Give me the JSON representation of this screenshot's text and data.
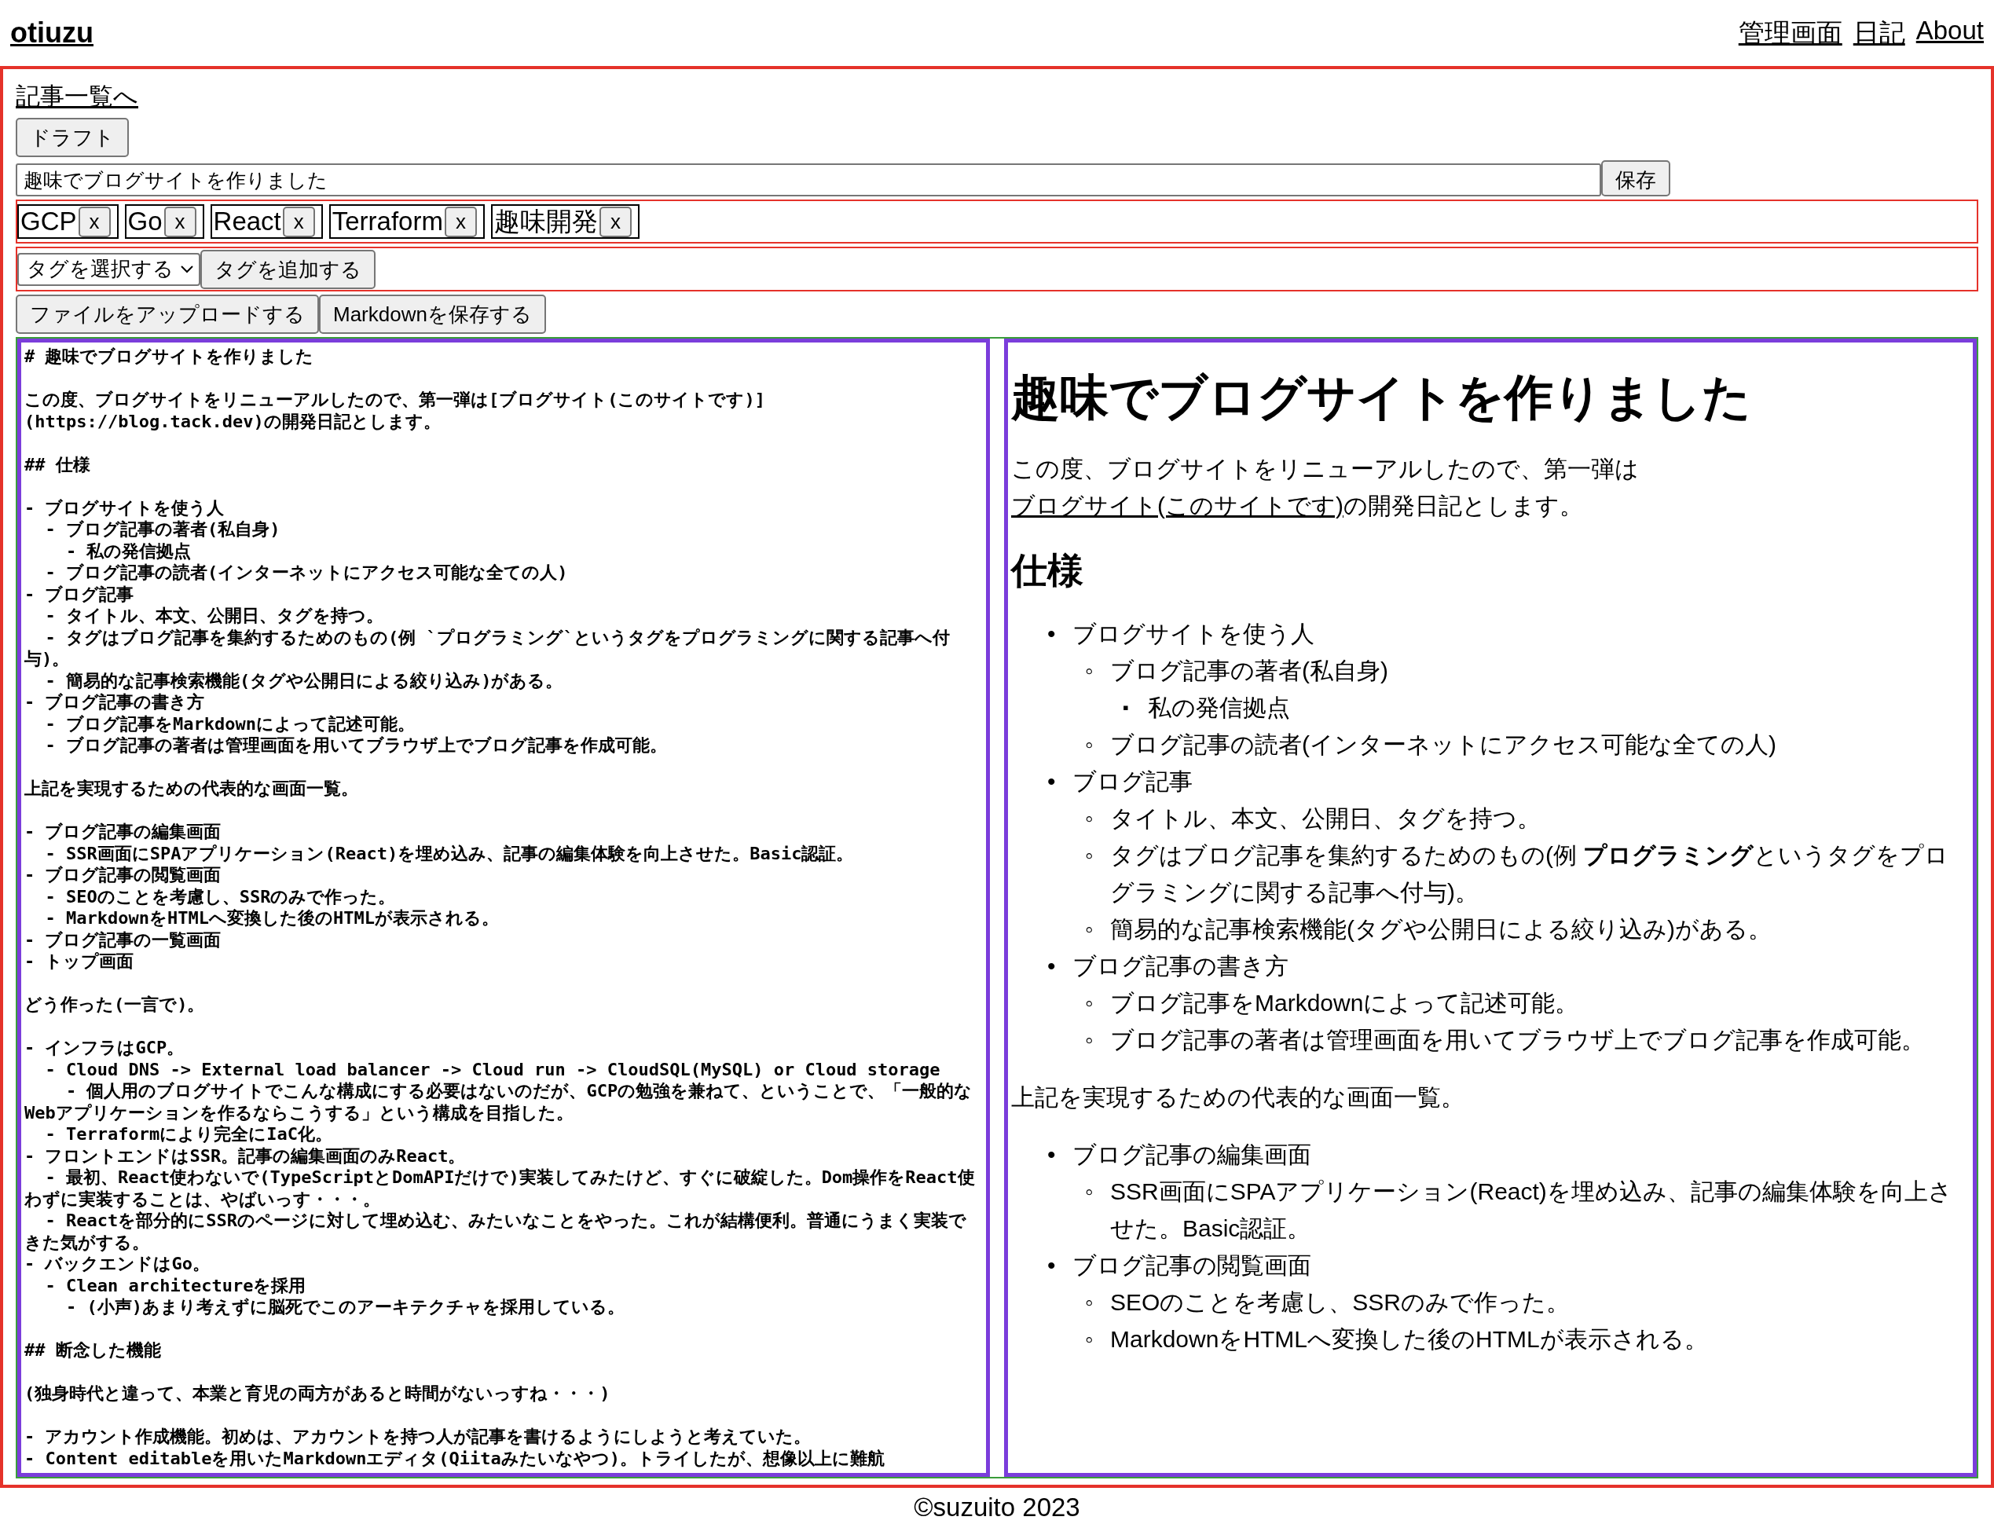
{
  "header": {
    "logo": "otiuzu",
    "nav": [
      "管理画面",
      "日記",
      "About"
    ]
  },
  "editor": {
    "back_link": "記事一覧へ",
    "draft_button": "ドラフト",
    "title_field": {
      "value": "趣味でブログサイトを作りました"
    },
    "save_button": "保存",
    "tags": [
      {
        "label": "GCP",
        "remove": "x"
      },
      {
        "label": "Go",
        "remove": "x"
      },
      {
        "label": "React",
        "remove": "x"
      },
      {
        "label": "Terraform",
        "remove": "x"
      },
      {
        "label": "趣味開発",
        "remove": "x"
      }
    ],
    "tag_select": {
      "value": "タグを選択する"
    },
    "add_tag_button": "タグを追加する",
    "upload_button": "ファイルをアップロードする",
    "save_markdown_button": "Markdownを保存する",
    "markdown_blocks": [
      [
        "# 趣味でブログサイトを作りました"
      ],
      [
        "この度、ブログサイトをリニューアルしたので、第一弾は[ブログサイト(このサイトです)](https://blog.tack.dev)の開発日記とします。"
      ],
      [
        "## 仕様"
      ],
      [
        "- ブログサイトを使う人",
        "  - ブログ記事の著者(私自身)",
        "    - 私の発信拠点",
        "  - ブログ記事の読者(インターネットにアクセス可能な全ての人)",
        "- ブログ記事",
        "  - タイトル、本文、公開日、タグを持つ。",
        "  - タグはブログ記事を集約するためのもの(例 `プログラミング`というタグをプログラミングに関する記事へ付与)。",
        "  - 簡易的な記事検索機能(タグや公開日による絞り込み)がある。",
        "- ブログ記事の書き方",
        "  - ブログ記事をMarkdownによって記述可能。",
        "  - ブログ記事の著者は管理画面を用いてブラウザ上でブログ記事を作成可能。"
      ],
      [
        "上記を実現するための代表的な画面一覧。"
      ],
      [
        "- ブログ記事の編集画面",
        "  - SSR画面にSPAアプリケーション(React)を埋め込み、記事の編集体験を向上させた。Basic認証。",
        "- ブログ記事の閲覧画面",
        "  - SEOのことを考慮し、SSRのみで作った。",
        "  - MarkdownをHTMLへ変換した後のHTMLが表示される。",
        "- ブログ記事の一覧画面",
        "- トップ画面"
      ],
      [
        "どう作った(一言で)。"
      ],
      [
        "- インフラはGCP。",
        "  - Cloud DNS -> External load balancer -> Cloud run -> CloudSQL(MySQL) or Cloud storage",
        "    - 個人用のブログサイトでこんな構成にする必要はないのだが、GCPの勉強を兼ねて、ということで、「一般的なWebアプリケーションを作るならこうする」という構成を目指した。",
        "  - Terraformにより完全にIaC化。",
        "- フロントエンドはSSR。記事の編集画面のみReact。",
        "  - 最初、React使わないで(TypeScriptとDomAPIだけで)実装してみたけど、すぐに破綻した。Dom操作をReact使わずに実装することは、やばいっす・・・。",
        "  - Reactを部分的にSSRのページに対して埋め込む、みたいなことをやった。これが結構便利。普通にうまく実装できた気がする。",
        "- バックエンドはGo。",
        "  - Clean architectureを採用",
        "    - (小声)あまり考えずに脳死でこのアーキテクチャを採用している。"
      ],
      [
        "## 断念した機能"
      ],
      [
        "(独身時代と違って、本業と育児の両方があると時間がないっすね・・・)"
      ],
      [
        "- アカウント作成機能。初めは、アカウントを持つ人が記事を書けるようにしようと考えていた。",
        "- Content editableを用いたMarkdownエディタ(Qiitaみたいなやつ)。トライしたが、想像以上に難航"
      ]
    ],
    "preview": [
      {
        "kind": "heading1",
        "text": "趣味でブログサイトを作りました"
      },
      {
        "kind": "paragraph",
        "text": "この度、ブログサイトをリニューアルしたので、第一弾は",
        "link": "ブログサイト(このサイトです)",
        "after": "の開発日記とします。"
      },
      {
        "kind": "heading2",
        "text": "仕様"
      },
      {
        "kind": "list",
        "items": [
          {
            "marker": "•",
            "text": "ブログサイトを使う人",
            "children": [
              {
                "marker": "◦",
                "text": "ブログ記事の著者(私自身)",
                "children": [
                  {
                    "marker": "▪",
                    "text": "私の発信拠点"
                  }
                ]
              },
              {
                "marker": "◦",
                "text": "ブログ記事の読者(インターネットにアクセス可能な全ての人)"
              }
            ]
          },
          {
            "marker": "•",
            "text": "ブログ記事",
            "children": [
              {
                "marker": "◦",
                "text": "タイトル、本文、公開日、タグを持つ。"
              },
              {
                "marker": "◦",
                "text": "タグはブログ記事を集約するためのもの(例 **プログラミング**というタグをプログラミングに関する記事へ付与)。"
              },
              {
                "marker": "◦",
                "text": "簡易的な記事検索機能(タグや公開日による絞り込み)がある。"
              }
            ]
          },
          {
            "marker": "•",
            "text": "ブログ記事の書き方",
            "children": [
              {
                "marker": "◦",
                "text": "ブログ記事をMarkdownによって記述可能。"
              },
              {
                "marker": "◦",
                "text": "ブログ記事の著者は管理画面を用いてブラウザ上でブログ記事を作成可能。"
              }
            ]
          }
        ]
      },
      {
        "kind": "paragraph",
        "text": "上記を実現するための代表的な画面一覧。"
      },
      {
        "kind": "list",
        "items": [
          {
            "marker": "•",
            "text": "ブログ記事の編集画面",
            "children": [
              {
                "marker": "◦",
                "text": "SSR画面にSPAアプリケーション(React)を埋め込み、記事の編集体験を向上させた。Basic認証。"
              }
            ]
          },
          {
            "marker": "•",
            "text": "ブログ記事の閲覧画面",
            "children": [
              {
                "marker": "◦",
                "text": "SEOのことを考慮し、SSRのみで作った。"
              },
              {
                "marker": "◦",
                "text": "MarkdownをHTMLへ変換した後のHTMLが表示される。"
              }
            ]
          }
        ]
      }
    ]
  },
  "footer": "©suzuito 2023"
}
